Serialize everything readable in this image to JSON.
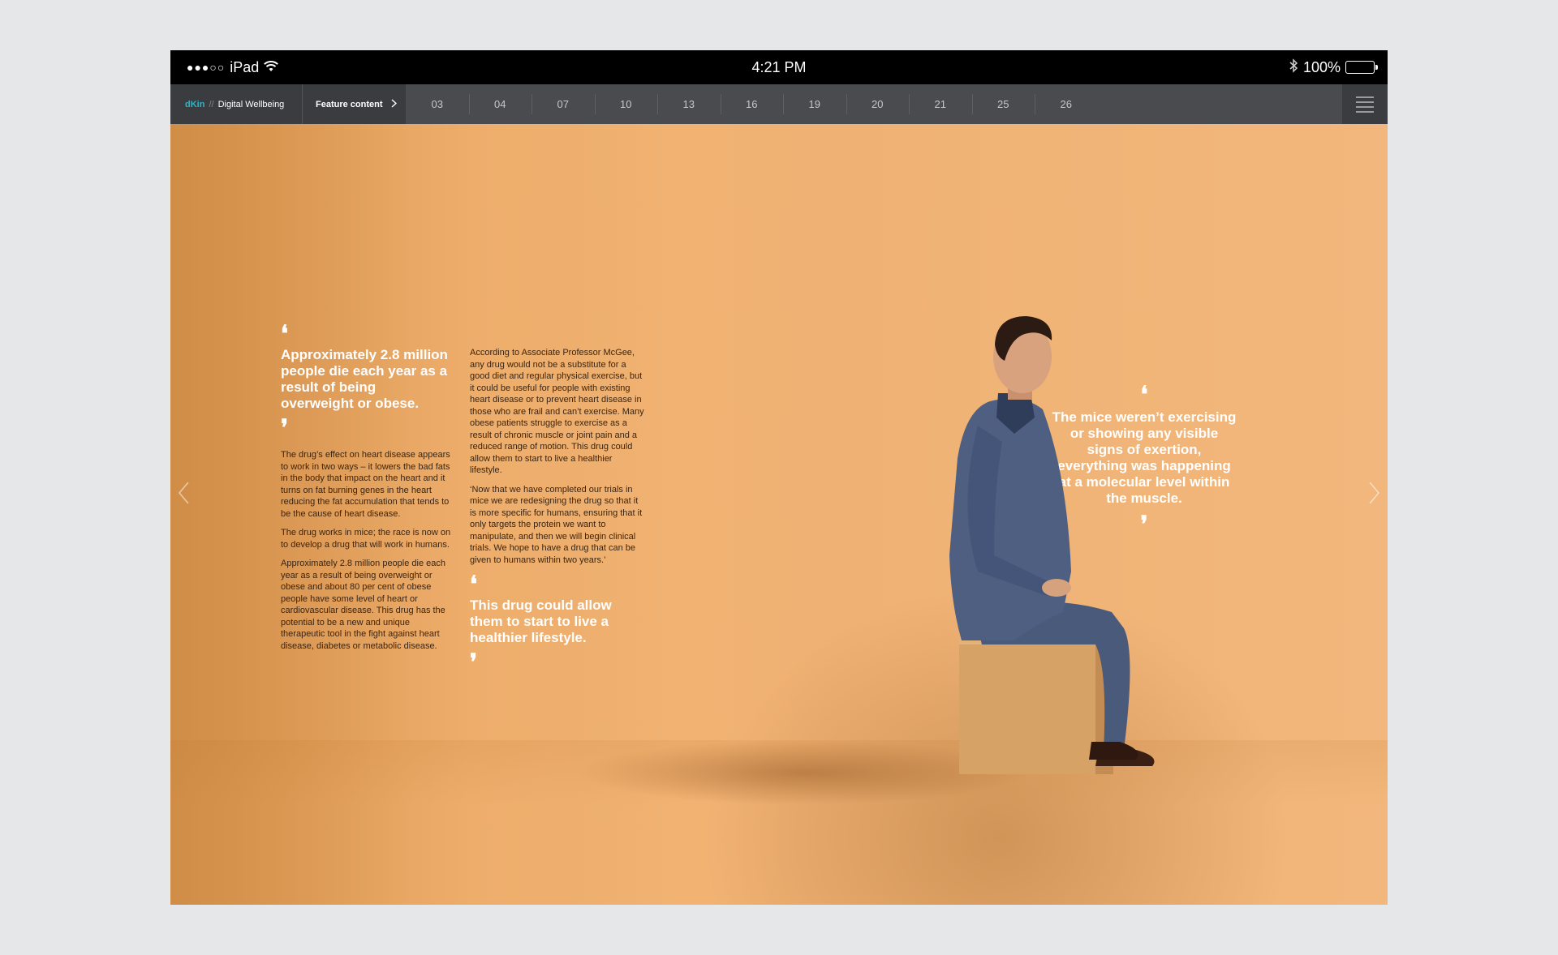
{
  "status_bar": {
    "signal": "●●●○○",
    "device": "iPad",
    "time": "4:21 PM",
    "battery": "100%"
  },
  "nav": {
    "brand_accent": "dKin",
    "brand_sep": "//",
    "brand_title": "Digital Wellbeing",
    "feature_label": "Feature content",
    "pages": [
      "03",
      "04",
      "07",
      "10",
      "13",
      "16",
      "19",
      "20",
      "21",
      "25",
      "26"
    ]
  },
  "article": {
    "pull_quote_1": "Approximately 2.8 million people die each year as a result of being overweight or obese.",
    "col1_paragraphs": [
      "The drug’s effect on heart disease appears to work in two ways – it lowers the bad fats in the body that impact on the heart and it turns on fat burning genes in the heart reducing the fat accumulation that tends to be the cause of heart disease.",
      "The drug works in mice; the race is now on to develop a drug that will work in humans.",
      "Approximately 2.8 million people die each year as a result of being overweight or obese and about 80 per cent of obese people have some level of heart or cardiovascular disease. This drug has the potential to be a new and unique therapeutic tool in the fight against heart disease, diabetes or metabolic disease."
    ],
    "col2_paragraphs": [
      "According to Associate Professor McGee, any drug would not be a substitute for a good diet and regular physical exercise, but it could be useful for people with existing heart disease or to prevent heart disease in those who are frail and can’t exercise. Many obese patients struggle to exercise as a result of chronic muscle or joint pain and a reduced range of motion. This drug could allow them to start to live a healthier lifestyle.",
      "‘Now that we have completed our trials in mice we are redesigning the drug so that it is more specific for humans, ensuring that it only targets the protein we want to manipulate, and then we will begin clinical trials. We hope to have a drug that can be given to humans within two years.’"
    ],
    "pull_quote_2": "This drug could allow them to start to live a healthier lifestyle.",
    "pull_quote_3": "The mice weren’t exercising or showing any visible signs of exertion, everything was happening at a molecular level within the muscle.",
    "open_quote": "❛",
    "close_quote": "❜"
  },
  "colors": {
    "accent": "#2bb6c9",
    "nav_bg": "#4a4b4f",
    "page_orange": "#efb171"
  }
}
